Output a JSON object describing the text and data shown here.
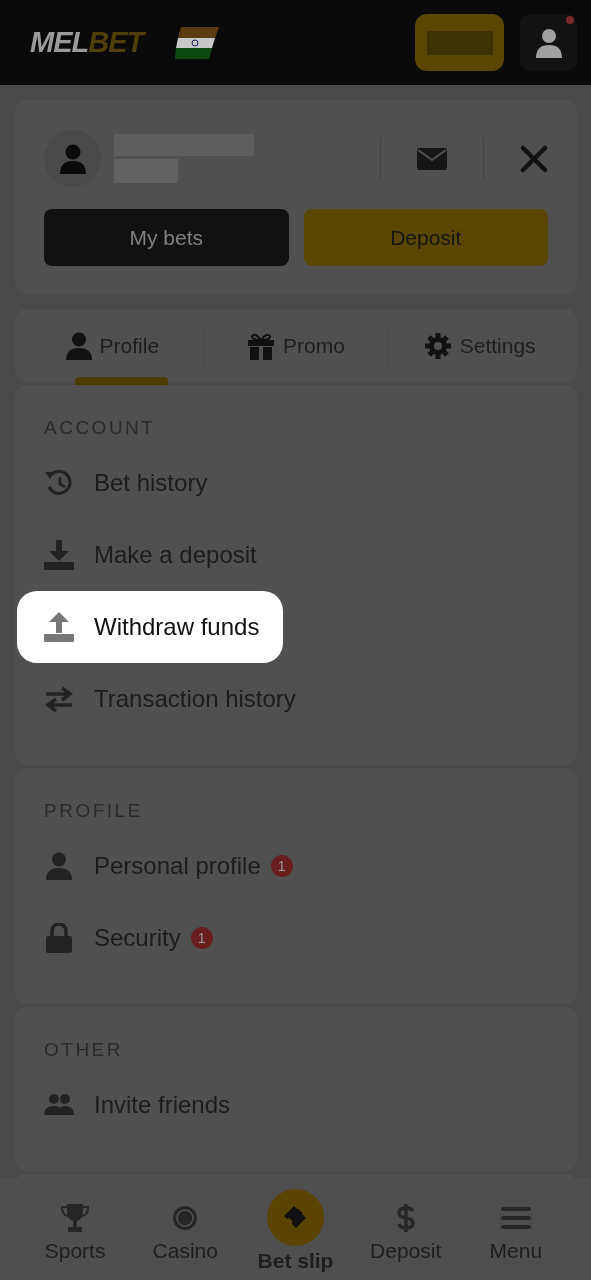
{
  "header": {
    "logo": {
      "lead": "MEL",
      "accent": "BET"
    },
    "notification_dot": true
  },
  "account_card": {
    "buttons": [
      {
        "label": "My bets",
        "kind": "dark"
      },
      {
        "label": "Deposit",
        "kind": "accent"
      }
    ]
  },
  "tabs": [
    {
      "label": "Profile",
      "selected": true
    },
    {
      "label": "Promo",
      "selected": false
    },
    {
      "label": "Settings",
      "selected": false
    }
  ],
  "sections": [
    {
      "title": "ACCOUNT",
      "items": [
        {
          "label": "Bet history",
          "highlighted": false
        },
        {
          "label": "Make a deposit",
          "highlighted": false
        },
        {
          "label": "Withdraw funds",
          "highlighted": true
        },
        {
          "label": "Transaction history",
          "highlighted": false
        }
      ]
    },
    {
      "title": "PROFILE",
      "items": [
        {
          "label": "Personal profile",
          "highlighted": false,
          "badge": "1"
        },
        {
          "label": "Security",
          "highlighted": false,
          "badge": "1"
        }
      ]
    },
    {
      "title": "OTHER",
      "items": [
        {
          "label": "Invite friends",
          "highlighted": false
        }
      ]
    }
  ],
  "bottom_nav": [
    {
      "label": "Sports",
      "selected": false
    },
    {
      "label": "Casino",
      "selected": false
    },
    {
      "label": "Bet slip",
      "selected": true
    },
    {
      "label": "Deposit",
      "selected": false
    },
    {
      "label": "Menu",
      "selected": false
    }
  ]
}
